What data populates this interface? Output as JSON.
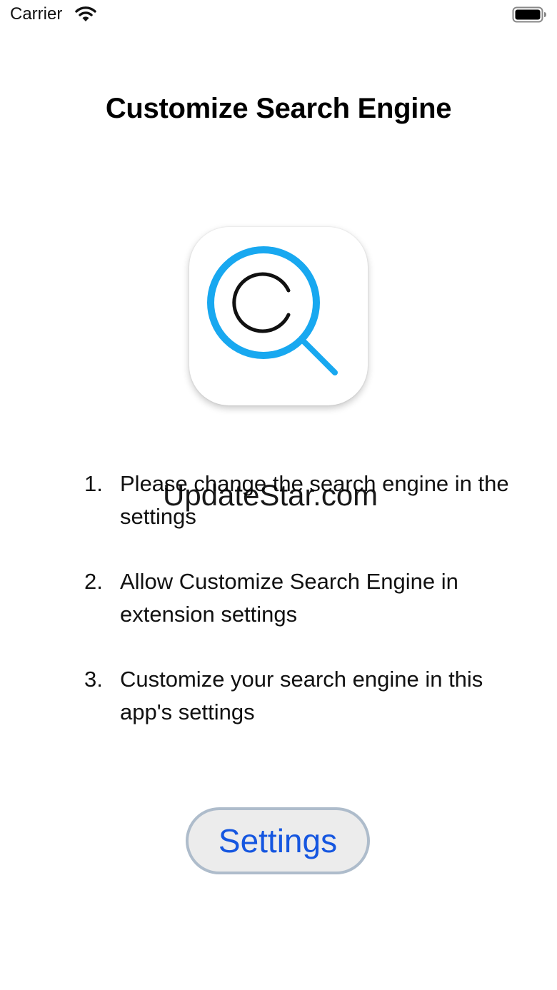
{
  "status_bar": {
    "carrier": "Carrier",
    "wifi_icon": "wifi-icon",
    "battery_icon": "battery-icon"
  },
  "title": "Customize Search Engine",
  "app_icon": {
    "icon": "magnifier-c-icon",
    "ring_color": "#18a8f0",
    "letter": "C"
  },
  "steps": [
    {
      "number": "1.",
      "text": "Please change the search engine in the settings"
    },
    {
      "number": "2.",
      "text": "Allow Customize Search Engine in extension settings"
    },
    {
      "number": "3.",
      "text": "Customize your search engine in this app's settings"
    }
  ],
  "watermark": "UpdateStar.com",
  "settings_button": {
    "label": "Settings",
    "color": "#1556e0"
  }
}
